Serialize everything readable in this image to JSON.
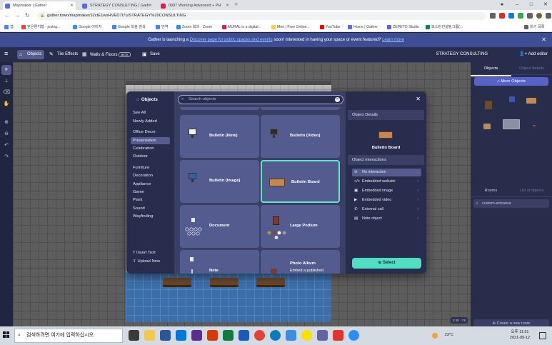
{
  "browser": {
    "tabs": [
      {
        "title": "Mapmaker | Gather",
        "color": "#4f6bff",
        "active": true
      },
      {
        "title": "STRATEGY CONSULTING | Gath",
        "color": "#4f6bff",
        "active": false
      },
      {
        "title": "0907 Working Advanced + PH",
        "color": "#e8174a",
        "active": false
      }
    ],
    "url": "gather.town/mapmaker/J2ctE1wsHVED7t7u/STRATEGY%20CONSULTING",
    "bookmarks": [
      {
        "label": "앱",
        "color": "#4285f4"
      },
      {
        "label": "받은편지함 - jnslog...",
        "color": "#ea4335"
      },
      {
        "label": "Google 이미지",
        "color": "#4285f4"
      },
      {
        "label": "Google 학술 검색",
        "color": "#4285f4"
      },
      {
        "label": "번역",
        "color": "#4285f4"
      },
      {
        "label": "Zoom 회의 - Zoom",
        "color": "#2d8cff"
      },
      {
        "label": "MURAL is a digital...",
        "color": "#e8174a"
      },
      {
        "label": "Miro | Free Online...",
        "color": "#ffd02f"
      },
      {
        "label": "YouTube",
        "color": "#ff0000"
      },
      {
        "label": "Home | Gather",
        "color": "#4f6bff"
      },
      {
        "label": "ZEPETO Studio",
        "color": "#5e5ef3"
      },
      {
        "label": "보스턴컨설팅그룹(...",
        "color": "#00864f"
      },
      {
        "label": "읽기 목록",
        "color": "#5f6368"
      }
    ]
  },
  "banner": {
    "text_before": "Gather is launching a ",
    "link_inline": "Discover page for public spaces and events",
    "text_after": " soon! Interested in having your space or event featured? ",
    "link": "Learn more",
    "close": "✕"
  },
  "toolbar": {
    "objects": "Objects",
    "tile_effects": "Tile Effects",
    "walls_floors": "Walls & Floors",
    "beta": "BETA",
    "save": "Save",
    "space_name": "STRATEGY CONSULTING",
    "add_editor": "Add editor"
  },
  "modal": {
    "title": "Objects",
    "categories": [
      "See All",
      "Newly Added",
      "Office Decor",
      "Presentation",
      "Celebration",
      "Outdoor",
      "Furniture",
      "Decoration",
      "Appliance",
      "Game",
      "Plant",
      "Sound",
      "Wayfinding"
    ],
    "selected_category": "Presentation",
    "insert_text": "Insert Text",
    "upload_new": "Upload New",
    "search_placeholder": "Search objects",
    "cards": [
      {
        "label": "Bulletin (Note)",
        "sub": ""
      },
      {
        "label": "Bulletin (Video)",
        "sub": ""
      },
      {
        "label": "Bulletin (Image)",
        "sub": ""
      },
      {
        "label": "Bulletin Board",
        "sub": ""
      },
      {
        "label": "Document",
        "sub": ""
      },
      {
        "label": "Large Podium",
        "sub": ""
      },
      {
        "label": "Note",
        "sub": ""
      },
      {
        "label": "Photo Album",
        "sub": "Embed a published"
      }
    ],
    "details": {
      "header": "Object Details",
      "name": "Bulletin Board",
      "interactions_header": "Object interactions",
      "options": [
        "No interaction",
        "Embedded website",
        "Embedded image",
        "Embedded video",
        "External call",
        "Note object"
      ],
      "selected_option": "No interaction",
      "select_button": "Select"
    }
  },
  "right_panel": {
    "tab_objects": "Objects",
    "tab_object_details": "Object details",
    "more_objects": "More Objects",
    "tab_rooms": "Rooms",
    "tab_list_of_objects": "List of objects",
    "room_item": "custom-entrance",
    "create_room": "Create a new room"
  },
  "canvas": {
    "zoom_indicator": "5:48 · Y8"
  },
  "taskbar": {
    "search_placeholder": "검색하려면 여기에 입력하십시오.",
    "weather": "23°C",
    "time": "오후 11:51",
    "date": "2021-09-12"
  }
}
